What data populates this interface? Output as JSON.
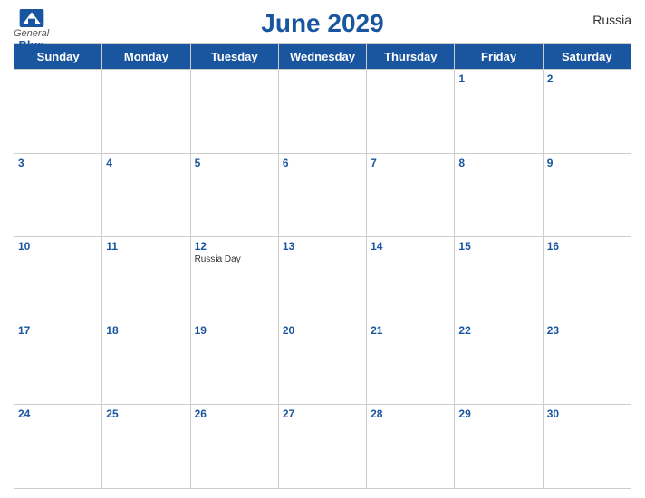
{
  "header": {
    "title": "June 2029",
    "country": "Russia",
    "logo": {
      "general": "General",
      "blue": "Blue"
    }
  },
  "weekdays": [
    "Sunday",
    "Monday",
    "Tuesday",
    "Wednesday",
    "Thursday",
    "Friday",
    "Saturday"
  ],
  "weeks": [
    [
      {
        "day": "",
        "event": ""
      },
      {
        "day": "",
        "event": ""
      },
      {
        "day": "",
        "event": ""
      },
      {
        "day": "",
        "event": ""
      },
      {
        "day": "",
        "event": ""
      },
      {
        "day": "1",
        "event": ""
      },
      {
        "day": "2",
        "event": ""
      }
    ],
    [
      {
        "day": "3",
        "event": ""
      },
      {
        "day": "4",
        "event": ""
      },
      {
        "day": "5",
        "event": ""
      },
      {
        "day": "6",
        "event": ""
      },
      {
        "day": "7",
        "event": ""
      },
      {
        "day": "8",
        "event": ""
      },
      {
        "day": "9",
        "event": ""
      }
    ],
    [
      {
        "day": "10",
        "event": ""
      },
      {
        "day": "11",
        "event": ""
      },
      {
        "day": "12",
        "event": "Russia Day"
      },
      {
        "day": "13",
        "event": ""
      },
      {
        "day": "14",
        "event": ""
      },
      {
        "day": "15",
        "event": ""
      },
      {
        "day": "16",
        "event": ""
      }
    ],
    [
      {
        "day": "17",
        "event": ""
      },
      {
        "day": "18",
        "event": ""
      },
      {
        "day": "19",
        "event": ""
      },
      {
        "day": "20",
        "event": ""
      },
      {
        "day": "21",
        "event": ""
      },
      {
        "day": "22",
        "event": ""
      },
      {
        "day": "23",
        "event": ""
      }
    ],
    [
      {
        "day": "24",
        "event": ""
      },
      {
        "day": "25",
        "event": ""
      },
      {
        "day": "26",
        "event": ""
      },
      {
        "day": "27",
        "event": ""
      },
      {
        "day": "28",
        "event": ""
      },
      {
        "day": "29",
        "event": ""
      },
      {
        "day": "30",
        "event": ""
      }
    ]
  ]
}
